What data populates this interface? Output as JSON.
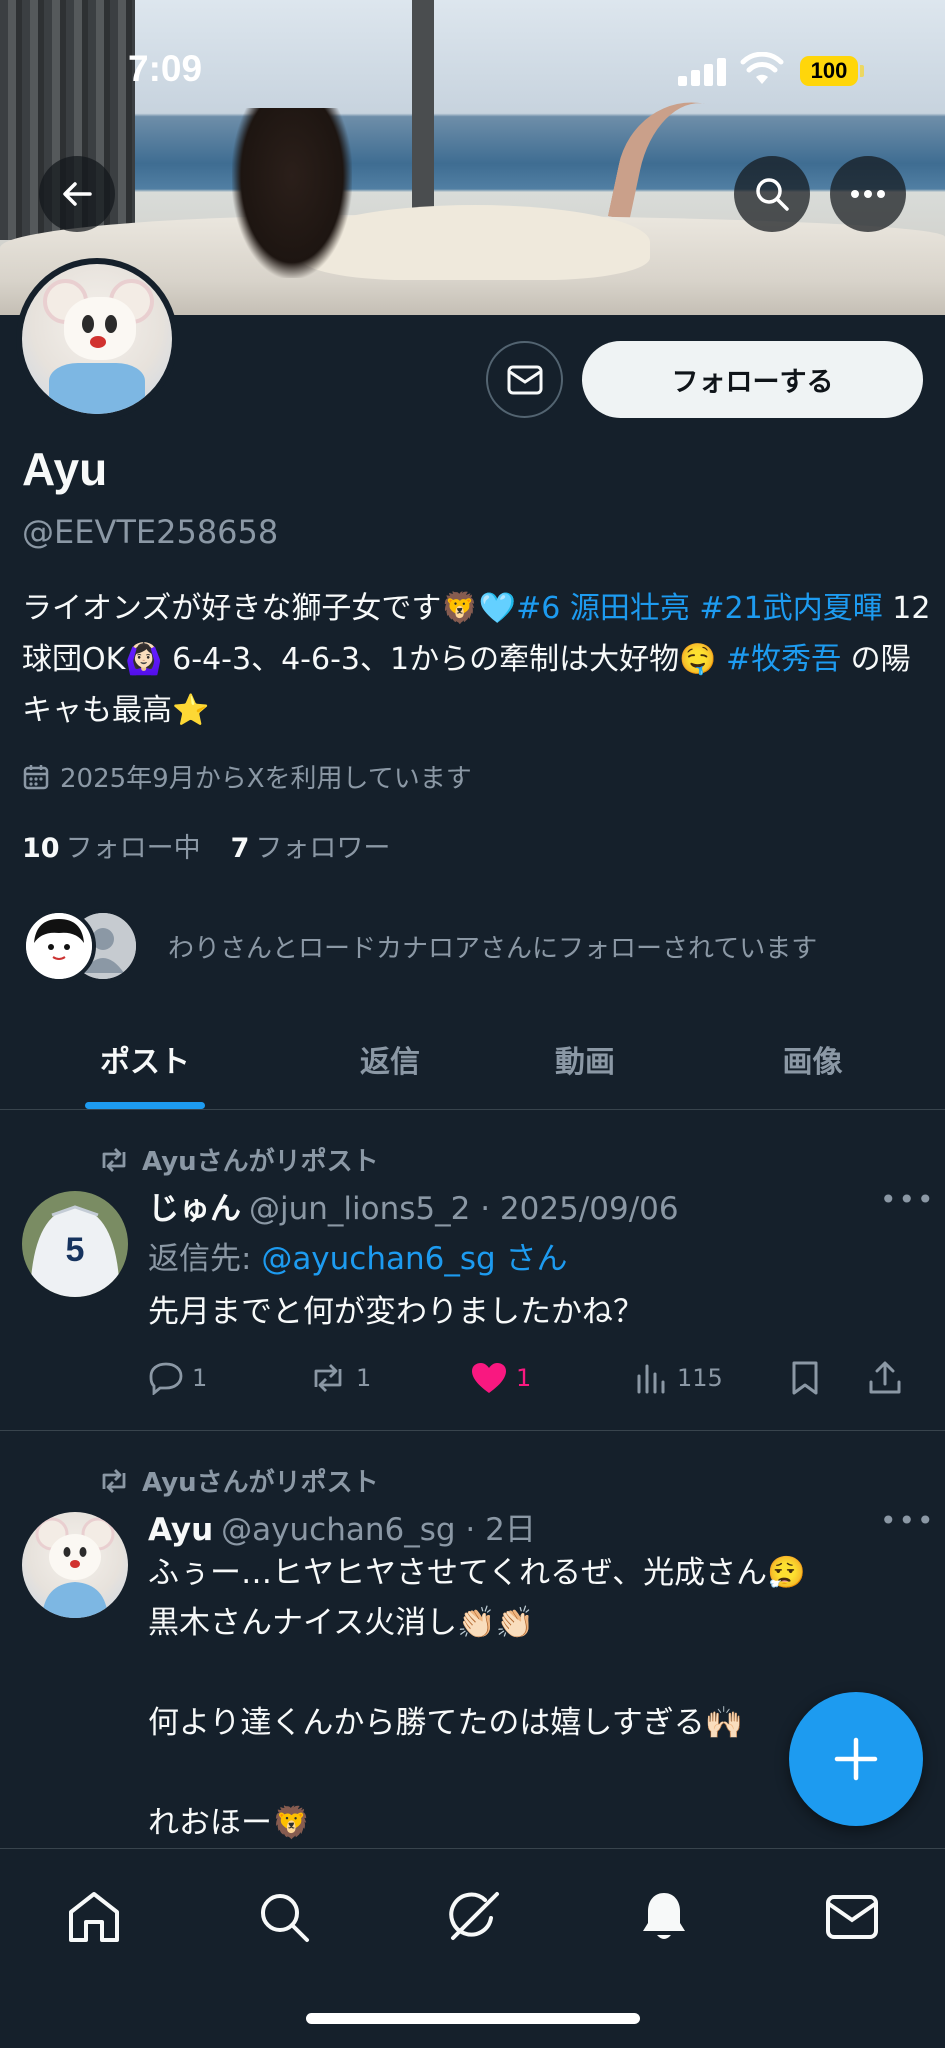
{
  "status_bar": {
    "time": "7:09",
    "battery": "100"
  },
  "profile": {
    "name": "Ayu",
    "handle": "@EEVTE258658",
    "follow_label": "フォローする",
    "bio": {
      "part1": "ライオンズが好きな獅子女です🦁🩵",
      "tag1": "#6 源田壮亮",
      "tag2": "#21武内夏暉",
      "part2": " 12球団OK🙆🏻‍♀️ 6-4-3、4-6-3、1からの牽制は大好物🤤 ",
      "tag3": "#牧秀吾",
      "part3": " の陽キャも最高⭐️"
    },
    "joined": "2025年9月からXを利用しています",
    "following_count": "10",
    "following_label": "フォロー中",
    "followers_count": "7",
    "followers_label": "フォロワー",
    "followed_by": "わりさんとロードカナロアさんにフォローされています"
  },
  "tabs": [
    {
      "label": "ポスト",
      "active": true
    },
    {
      "label": "返信",
      "active": false
    },
    {
      "label": "動画",
      "active": false
    },
    {
      "label": "画像",
      "active": false
    }
  ],
  "posts": [
    {
      "repost_by": "Ayuさんがリポスト",
      "author": "じゅん",
      "handle_date": "@jun_lions5_2 · 2025/09/06",
      "reply_prefix": "返信先: ",
      "reply_to": "@ayuchan6_sg さん",
      "text": "先月までと何が変わりましたかね？",
      "replies": "1",
      "reposts": "1",
      "likes": "1",
      "views": "115",
      "liked": true
    },
    {
      "repost_by": "Ayuさんがリポスト",
      "author": "Ayu",
      "handle_date": "@ayuchan6_sg · 2日",
      "text": "ふぅー…ヒヤヒヤさせてくれるぜ、光成さん😮‍💨\n黒木さんナイス火消し👏🏻👏🏻\n\n何より達くんから勝てたのは嬉しすぎる🙌🏻\n\nれおほー🦁"
    }
  ],
  "colors": {
    "accent": "#1d9bf0",
    "background": "#15202b",
    "like": "#f91880",
    "muted": "#8b98a5"
  },
  "icons": [
    "back-arrow-icon",
    "search-icon",
    "more-icon",
    "mail-icon",
    "calendar-icon",
    "repost-icon",
    "reply-icon",
    "heart-icon",
    "views-icon",
    "bookmark-icon",
    "share-icon",
    "plus-icon",
    "home-icon",
    "grok-icon",
    "bell-icon"
  ]
}
